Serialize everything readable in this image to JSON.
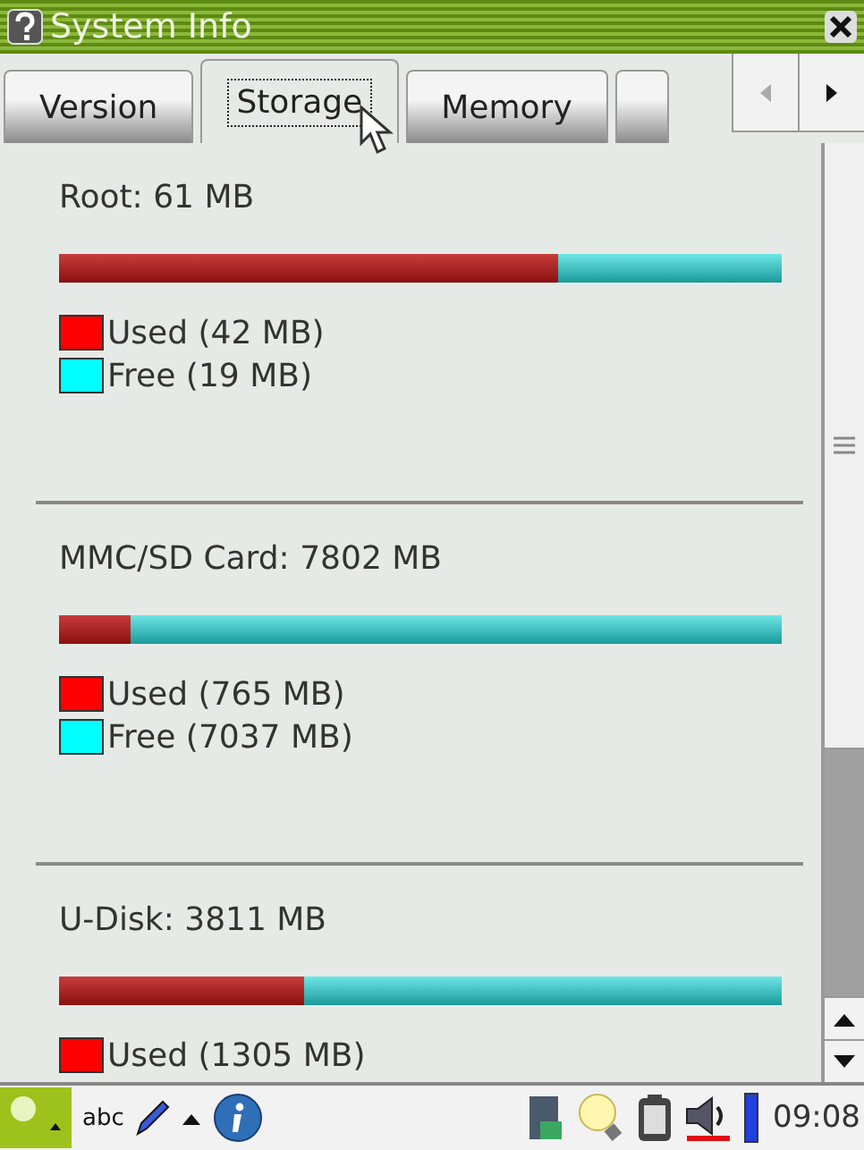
{
  "window": {
    "title": "System Info"
  },
  "tabs": [
    {
      "label": "Version",
      "selected": false
    },
    {
      "label": "Storage",
      "selected": true
    },
    {
      "label": "Memory",
      "selected": false
    },
    {
      "selected": false
    }
  ],
  "sections": [
    {
      "title": "Root: 61 MB",
      "level": 0.69,
      "legend": [
        {
          "label": "Used (42 MB)",
          "color": "#ff0000"
        },
        {
          "label": "Free (19 MB)",
          "color": "#00ffff"
        }
      ]
    },
    {
      "title": "MMC/SD Card: 7802 MB",
      "level": 0.098,
      "legend": [
        {
          "label": "Used (765 MB)",
          "color": "#ff0000"
        },
        {
          "label": "Free (7037 MB)",
          "color": "#00ffff"
        }
      ]
    },
    {
      "title": "U-Disk: 3811 MB",
      "level": 0.34,
      "legend": [
        {
          "label": "Used (1305 MB)",
          "color": "#ff0000"
        }
      ]
    }
  ],
  "taskbar": {
    "input_label": "abc",
    "clock": "09:08"
  }
}
